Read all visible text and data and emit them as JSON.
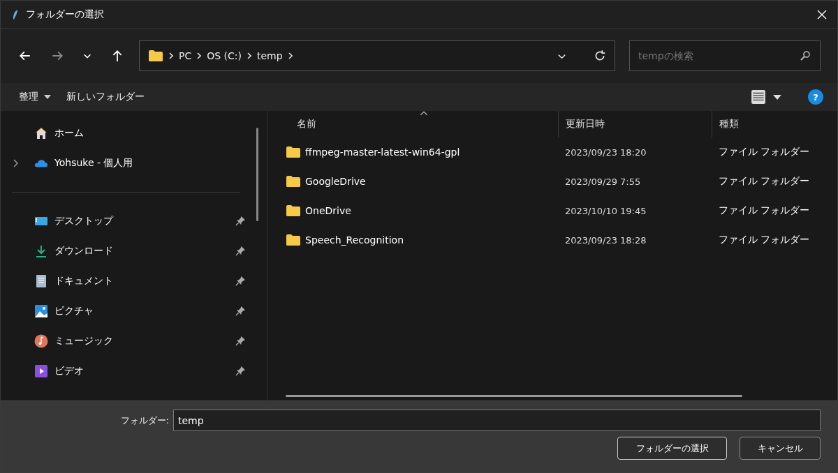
{
  "window": {
    "title": "フォルダーの選択"
  },
  "nav": {
    "breadcrumbs": [
      "PC",
      "OS (C:)",
      "temp"
    ],
    "search": {
      "placeholder": "tempの検索"
    }
  },
  "commands": [
    "整理",
    "新しいフォルダー"
  ],
  "sidebar": {
    "top": [
      {
        "label": "ホーム",
        "kind": "home",
        "expandable": false
      },
      {
        "label": "Yohsuke - 個人用",
        "kind": "cloud",
        "expandable": true
      }
    ],
    "pinned": [
      {
        "label": "デスクトップ",
        "kind": "desktop"
      },
      {
        "label": "ダウンロード",
        "kind": "download"
      },
      {
        "label": "ドキュメント",
        "kind": "document"
      },
      {
        "label": "ピクチャ",
        "kind": "picture"
      },
      {
        "label": "ミュージック",
        "kind": "music"
      },
      {
        "label": "ビデオ",
        "kind": "video"
      }
    ]
  },
  "table": {
    "columns": [
      "名前",
      "更新日時",
      "種類"
    ],
    "rows": [
      {
        "name": "ffmpeg-master-latest-win64-gpl",
        "modified": "2023/09/23 18:20",
        "type": "ファイル フォルダー"
      },
      {
        "name": "GoogleDrive",
        "modified": "2023/09/29 7:55",
        "type": "ファイル フォルダー"
      },
      {
        "name": "OneDrive",
        "modified": "2023/10/10 19:45",
        "type": "ファイル フォルダー"
      },
      {
        "name": "Speech_Recognition",
        "modified": "2023/09/23 18:28",
        "type": "ファイル フォルダー"
      }
    ]
  },
  "help": "?",
  "footer": {
    "label": "フォルダー:",
    "value": "temp",
    "buttons": [
      "フォルダーの選択",
      "キャンセル"
    ]
  }
}
